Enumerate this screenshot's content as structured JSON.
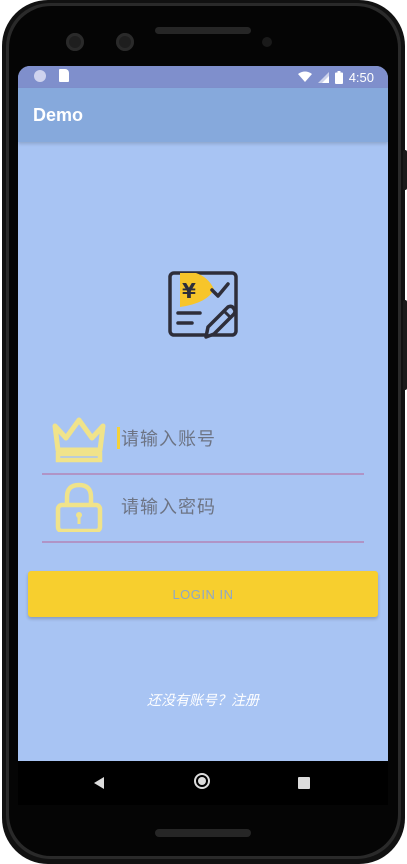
{
  "status_bar": {
    "time": "4:50",
    "icons": [
      "circle-notification-icon",
      "sd-card-icon",
      "wifi-icon",
      "signal-icon",
      "battery-icon"
    ]
  },
  "app_bar": {
    "title": "Demo"
  },
  "logo": {
    "icon": "bill-edit-icon",
    "symbol": "¥"
  },
  "account_field": {
    "icon": "crown-icon",
    "placeholder": "请输入账号",
    "value": ""
  },
  "password_field": {
    "icon": "lock-icon",
    "placeholder": "请输入密码",
    "value": ""
  },
  "login_button": {
    "label": "LOGIN IN"
  },
  "register_link": {
    "text": "还没有账号？注册"
  },
  "nav_bar": {
    "buttons": [
      "back-icon",
      "home-icon",
      "recent-apps-icon"
    ]
  },
  "colors": {
    "screen_bg": "#a8c4f3",
    "app_bar": "#86a9dc",
    "status_bar": "#7f8fcc",
    "accent_yellow": "#f7cf2e",
    "icon_outline_yellow": "#f0e38a",
    "underline": "#b094c6"
  }
}
